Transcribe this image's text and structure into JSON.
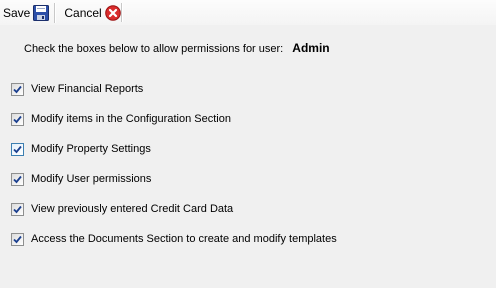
{
  "toolbar": {
    "save_label": "Save",
    "save_icon": "floppy-disk-icon",
    "cancel_label": "Cancel",
    "cancel_icon": "red-x-circle-icon"
  },
  "prompt": {
    "text": "Check the boxes below to allow permissions for user:",
    "user": "Admin"
  },
  "permissions": [
    {
      "label": "View Financial Reports",
      "checked": true
    },
    {
      "label": "Modify items in the Configuration Section",
      "checked": true
    },
    {
      "label": "Modify Property Settings",
      "checked": true
    },
    {
      "label": "Modify User permissions",
      "checked": true
    },
    {
      "label": "View previously entered Credit Card Data",
      "checked": true
    },
    {
      "label": "Access the Documents Section to create and modify templates",
      "checked": true
    }
  ],
  "colors": {
    "check": "#1a3f8f",
    "cancel_red": "#d92c2c",
    "save_blue": "#2c4fa8"
  }
}
